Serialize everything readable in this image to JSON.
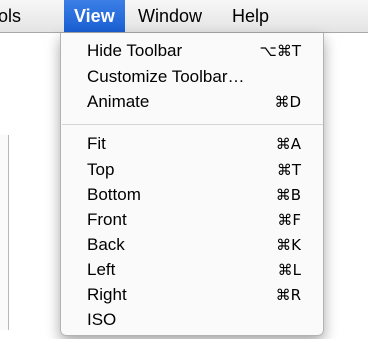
{
  "menubar": {
    "items": [
      {
        "label": "ols"
      },
      {
        "label": "View"
      },
      {
        "label": "Window"
      },
      {
        "label": "Help"
      }
    ]
  },
  "view_menu": {
    "items": [
      {
        "label": "Hide Toolbar",
        "shortcut": "⌥⌘T"
      },
      {
        "label": "Customize Toolbar…",
        "shortcut": ""
      },
      {
        "label": "Animate",
        "shortcut": "⌘D"
      },
      {
        "label": "Fit",
        "shortcut": "⌘A"
      },
      {
        "label": "Top",
        "shortcut": "⌘T"
      },
      {
        "label": "Bottom",
        "shortcut": "⌘B"
      },
      {
        "label": "Front",
        "shortcut": "⌘F"
      },
      {
        "label": "Back",
        "shortcut": "⌘K"
      },
      {
        "label": "Left",
        "shortcut": "⌘L"
      },
      {
        "label": "Right",
        "shortcut": "⌘R"
      },
      {
        "label": "ISO",
        "shortcut": ""
      }
    ]
  },
  "colors": {
    "menu_highlight": "#1a5fd4",
    "menu_background": "#fafafa",
    "separator": "#d4d4d4"
  }
}
